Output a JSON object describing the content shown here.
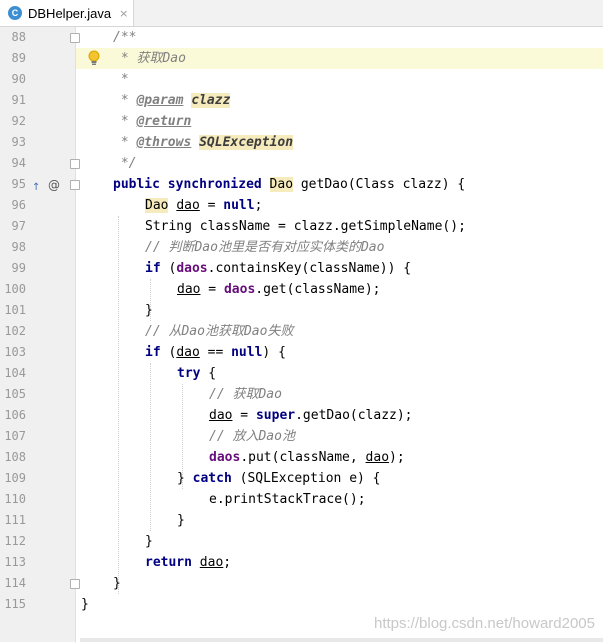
{
  "tab": {
    "icon": "C",
    "label": "DBHelper.java",
    "close": "×"
  },
  "lines": [
    {
      "n": "88",
      "code": "/**"
    },
    {
      "n": "89",
      "code": " * 获取Dao"
    },
    {
      "n": "90",
      "code": " *"
    },
    {
      "n": "91",
      "prefix": " * ",
      "tag": "@param",
      "value": "clazz"
    },
    {
      "n": "92",
      "prefix": " * ",
      "tag": "@return"
    },
    {
      "n": "93",
      "prefix": " * ",
      "tag": "@throws",
      "value": "SQLException"
    },
    {
      "n": "94",
      "code": " */"
    },
    {
      "n": "95",
      "kw1": "public",
      "kw2": "synchronized",
      "type": "Dao",
      "rest": " getDao(Class clazz) {"
    },
    {
      "n": "96",
      "type": "Dao",
      "var": "dao",
      "rest": " = ",
      "kw": "null",
      "end": ";"
    },
    {
      "n": "97",
      "code": "String className = clazz.getSimpleName();"
    },
    {
      "n": "98",
      "code": "// 判断Dao池里是否有对应实体类的Dao"
    },
    {
      "n": "99",
      "kw": "if",
      "open": " (",
      "field": "daos",
      "rest": ".containsKey(className)) {"
    },
    {
      "n": "100",
      "var": "dao",
      "mid": " = ",
      "field": "daos",
      "rest": ".get(className);"
    },
    {
      "n": "101",
      "code": "}"
    },
    {
      "n": "102",
      "code": "// 从Dao池获取Dao失败"
    },
    {
      "n": "103",
      "kw": "if",
      "open": " (",
      "var": "dao",
      "mid": " == ",
      "kw2": "null",
      "rest": ") {"
    },
    {
      "n": "104",
      "kw": "try",
      "rest": " {"
    },
    {
      "n": "105",
      "code": "// 获取Dao"
    },
    {
      "n": "106",
      "var": "dao",
      "mid": " = ",
      "kw": "super",
      "rest": ".getDao(clazz);"
    },
    {
      "n": "107",
      "code": "// 放入Dao池"
    },
    {
      "n": "108",
      "field": "daos",
      "rest": ".put(className, ",
      "var": "dao",
      "end": ");"
    },
    {
      "n": "109",
      "open": "} ",
      "kw": "catch",
      "rest": " (SQLException e) {"
    },
    {
      "n": "110",
      "code": "e.printStackTrace();"
    },
    {
      "n": "111",
      "code": "}"
    },
    {
      "n": "112",
      "code": "}"
    },
    {
      "n": "113",
      "kw": "return",
      "mid": " ",
      "var": "dao",
      "end": ";"
    },
    {
      "n": "114",
      "code": "}"
    },
    {
      "n": "115",
      "code": "}"
    }
  ],
  "watermark": "https://blog.csdn.net/howard2005",
  "gutter_icons": {
    "bulb": "lightbulb-icon",
    "override": "↑",
    "annotation": "@"
  },
  "colors": {
    "keyword": "#000080",
    "comment": "#808080",
    "field": "#660e7a",
    "highlight": "#f6ebbc",
    "current_line": "#fbfad8"
  }
}
